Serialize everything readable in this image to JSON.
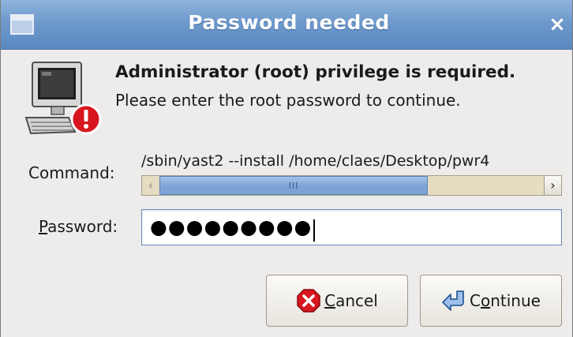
{
  "window": {
    "title": "Password needed",
    "close_glyph": "×",
    "icon": "window-menu-icon"
  },
  "dialog": {
    "icon": "computer-warning-icon",
    "heading": "Administrator (root) privilege is required.",
    "message": "Please enter the root password to continue."
  },
  "command": {
    "label": "Command:",
    "value": "/sbin/yast2 --install /home/claes/Desktop/pwr4",
    "scroll_left_glyph": "‹",
    "scroll_right_glyph": "›",
    "scroll_grip": "III"
  },
  "password": {
    "label_mnemonic": "P",
    "label_rest": "assword:",
    "masked_value": "●●●●●●●●●"
  },
  "buttons": {
    "cancel": {
      "mnemonic": "C",
      "rest": "ancel",
      "icon": "cancel-icon"
    },
    "continue": {
      "prefix": "C",
      "mnemonic": "o",
      "rest": "ntinue",
      "icon": "continue-arrow-icon"
    }
  },
  "colors": {
    "titlebar": "#6e99cc",
    "background": "#edeceb",
    "scroll_thumb": "#7da4d4",
    "warning_red": "#d8161e"
  }
}
